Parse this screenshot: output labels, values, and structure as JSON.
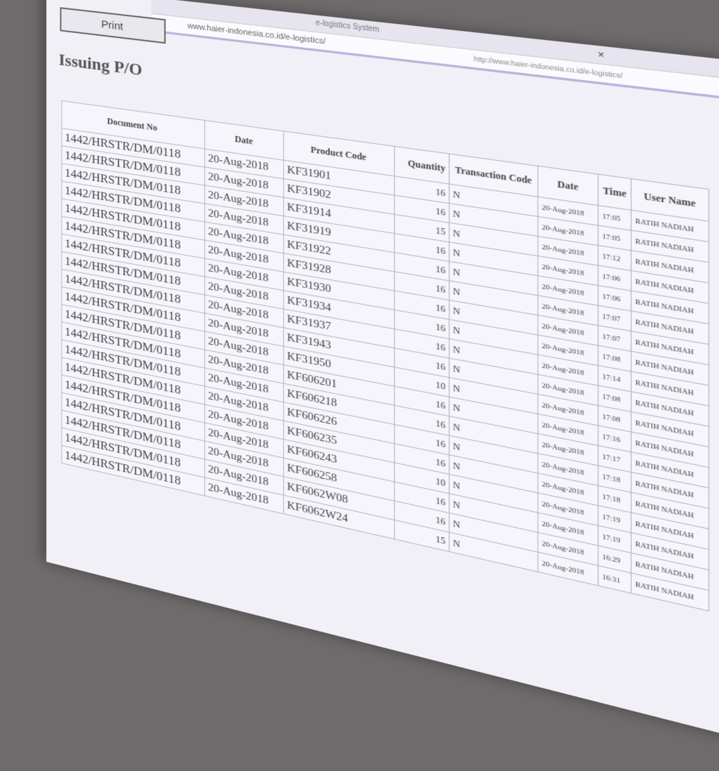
{
  "window": {
    "tab_title": "e-logistics System",
    "url": "www.haier-indonesia.co.id/e-logistics/",
    "url_secondary": "http://www.haier-indonesia.co.id/e-logistics/"
  },
  "toolbar": {
    "print_label": "Print"
  },
  "page": {
    "title": "Issuing P/O"
  },
  "table": {
    "headers": {
      "document_no": "Document No",
      "date": "Date",
      "product_code": "Product Code",
      "quantity": "Quantity",
      "transaction_code": "Transaction Code",
      "date2": "Date",
      "time": "Time",
      "user_name": "User Name"
    },
    "rows": [
      {
        "doc": "1442/HRSTR/DM/0118",
        "date": "20-Aug-2018",
        "product": "KF31901",
        "qty": "16",
        "tx": "N",
        "date2": "20-Aug-2018",
        "time": "17:05",
        "user": "RATIH NADIAH"
      },
      {
        "doc": "1442/HRSTR/DM/0118",
        "date": "20-Aug-2018",
        "product": "KF31902",
        "qty": "16",
        "tx": "N",
        "date2": "20-Aug-2018",
        "time": "17:05",
        "user": "RATIH NADIAH"
      },
      {
        "doc": "1442/HRSTR/DM/0118",
        "date": "20-Aug-2018",
        "product": "KF31914",
        "qty": "15",
        "tx": "N",
        "date2": "20-Aug-2018",
        "time": "17:12",
        "user": "RATIH NADIAH"
      },
      {
        "doc": "1442/HRSTR/DM/0118",
        "date": "20-Aug-2018",
        "product": "KF31919",
        "qty": "16",
        "tx": "N",
        "date2": "20-Aug-2018",
        "time": "17:06",
        "user": "RATIH NADIAH"
      },
      {
        "doc": "1442/HRSTR/DM/0118",
        "date": "20-Aug-2018",
        "product": "KF31922",
        "qty": "16",
        "tx": "N",
        "date2": "20-Aug-2018",
        "time": "17:06",
        "user": "RATIH NADIAH"
      },
      {
        "doc": "1442/HRSTR/DM/0118",
        "date": "20-Aug-2018",
        "product": "KF31928",
        "qty": "16",
        "tx": "N",
        "date2": "20-Aug-2018",
        "time": "17:07",
        "user": "RATIH NADIAH"
      },
      {
        "doc": "1442/HRSTR/DM/0118",
        "date": "20-Aug-2018",
        "product": "KF31930",
        "qty": "16",
        "tx": "N",
        "date2": "20-Aug-2018",
        "time": "17:07",
        "user": "RATIH NADIAH"
      },
      {
        "doc": "1442/HRSTR/DM/0118",
        "date": "20-Aug-2018",
        "product": "KF31934",
        "qty": "16",
        "tx": "N",
        "date2": "20-Aug-2018",
        "time": "17:08",
        "user": "RATIH NADIAH"
      },
      {
        "doc": "1442/HRSTR/DM/0118",
        "date": "20-Aug-2018",
        "product": "KF31937",
        "qty": "16",
        "tx": "N",
        "date2": "20-Aug-2018",
        "time": "17:14",
        "user": "RATIH NADIAH"
      },
      {
        "doc": "1442/HRSTR/DM/0118",
        "date": "20-Aug-2018",
        "product": "KF31943",
        "qty": "16",
        "tx": "N",
        "date2": "20-Aug-2018",
        "time": "17:08",
        "user": "RATIH NADIAH"
      },
      {
        "doc": "1442/HRSTR/DM/0118",
        "date": "20-Aug-2018",
        "product": "KF31950",
        "qty": "10",
        "tx": "N",
        "date2": "20-Aug-2018",
        "time": "17:08",
        "user": "RATIH NADIAH"
      },
      {
        "doc": "1442/HRSTR/DM/0118",
        "date": "20-Aug-2018",
        "product": "KF606201",
        "qty": "16",
        "tx": "N",
        "date2": "20-Aug-2018",
        "time": "17:16",
        "user": "RATIH NADIAH"
      },
      {
        "doc": "1442/HRSTR/DM/0118",
        "date": "20-Aug-2018",
        "product": "KF606218",
        "qty": "16",
        "tx": "N",
        "date2": "20-Aug-2018",
        "time": "17:17",
        "user": "RATIH NADIAH"
      },
      {
        "doc": "1442/HRSTR/DM/0118",
        "date": "20-Aug-2018",
        "product": "KF606226",
        "qty": "16",
        "tx": "N",
        "date2": "20-Aug-2018",
        "time": "17:18",
        "user": "RATIH NADIAH"
      },
      {
        "doc": "1442/HRSTR/DM/0118",
        "date": "20-Aug-2018",
        "product": "KF606235",
        "qty": "16",
        "tx": "N",
        "date2": "20-Aug-2018",
        "time": "17:18",
        "user": "RATIH NADIAH"
      },
      {
        "doc": "1442/HRSTR/DM/0118",
        "date": "20-Aug-2018",
        "product": "KF606243",
        "qty": "10",
        "tx": "N",
        "date2": "20-Aug-2018",
        "time": "17:19",
        "user": "RATIH NADIAH"
      },
      {
        "doc": "1442/HRSTR/DM/0118",
        "date": "20-Aug-2018",
        "product": "KF606258",
        "qty": "16",
        "tx": "N",
        "date2": "20-Aug-2018",
        "time": "17:19",
        "user": "RATIH NADIAH"
      },
      {
        "doc": "1442/HRSTR/DM/0118",
        "date": "20-Aug-2018",
        "product": "KF6062W08",
        "qty": "16",
        "tx": "N",
        "date2": "20-Aug-2018",
        "time": "16:29",
        "user": "RATIH NADIAH"
      },
      {
        "doc": "1442/HRSTR/DM/0118",
        "date": "20-Aug-2018",
        "product": "KF6062W24",
        "qty": "15",
        "tx": "N",
        "date2": "20-Aug-2018",
        "time": "16:31",
        "user": "RATIH NADIAH"
      }
    ]
  }
}
